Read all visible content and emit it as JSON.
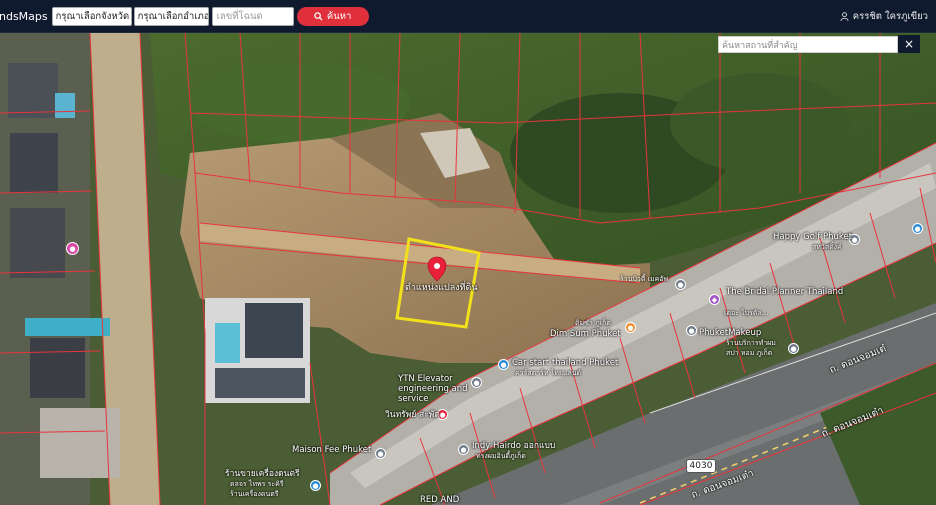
{
  "topbar": {
    "brand": "ndsMaps",
    "province_select": "กรุณาเลือกจังหวัด",
    "district_select": "กรุณาเลือกอำเภอ",
    "deed_placeholder": "เลขที่โฉนด",
    "search_label": "ค้นหา",
    "user_name": "ครรชิต ใครภูเขียว"
  },
  "place_search": {
    "placeholder": "ค้นหาสถานที่สำคัญ",
    "close": "×"
  },
  "map": {
    "parcel_label": "ตำแหน่งแปลงที่ดิน",
    "road_shield": "4030",
    "road_name_1": "ถ. ดอนจอมเต๋",
    "road_name_2": "ถ. ดอนจอมเต๋า",
    "road_name_3": "ถ. ดอนจอมเต๋า",
    "pois": [
      "Happy Golf Phuket",
      "สหวิสดิ้งค์",
      "The Bridal Planner Thailand",
      "เดอะ ไบรดัล...",
      "Dim Sum Phuket",
      "ติ่มซำ ภูเก็ต",
      "ร้านบิวตี้ เมคอัพ",
      "Car start thailand Phuket",
      "คาร์สตาร์ท ไทยแลนด์",
      "PhuketMakeup",
      "ร้านบริการทำผม",
      "สปา หอม ภูเก็ต",
      "YTN Elevator engineering and service",
      "วินทรัพย์ สะพัด",
      "Maison Fee Phuket",
      "Indy Hairdo ออกแบบ",
      "ทรงผมอินดี้ภูเก็ต",
      "ร้านขายเครื่องดนตรี",
      "ดลจร ไทพร ระคิรี",
      "ร้านเครื่องดนตรี",
      "RED AND"
    ]
  },
  "colors": {
    "topbar": "#0f1a2e",
    "search_button": "#e0303c",
    "parcel_lines": "#e8343c",
    "highlight": "#f2e01a",
    "marker": "#e8203a"
  }
}
